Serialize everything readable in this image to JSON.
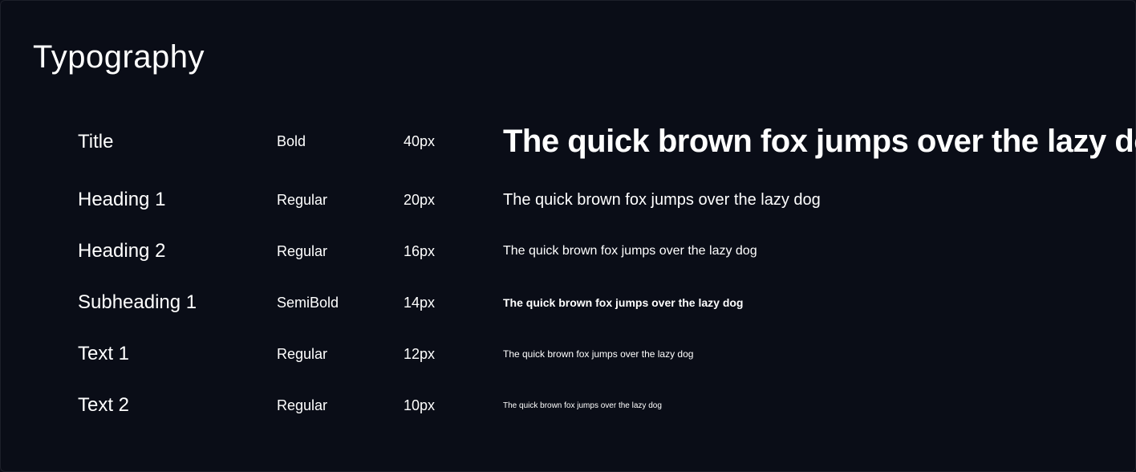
{
  "title": "Typography",
  "sample_text": "The quick brown fox jumps over the lazy dog",
  "rows": [
    {
      "name": "Title",
      "weight": "Bold",
      "size": "40px",
      "sample_class": "s-title"
    },
    {
      "name": "Heading 1",
      "weight": "Regular",
      "size": "20px",
      "sample_class": "s-h1"
    },
    {
      "name": "Heading 2",
      "weight": "Regular",
      "size": "16px",
      "sample_class": "s-h2"
    },
    {
      "name": "Subheading 1",
      "weight": "SemiBold",
      "size": "14px",
      "sample_class": "s-sub1"
    },
    {
      "name": "Text 1",
      "weight": "Regular",
      "size": "12px",
      "sample_class": "s-t1"
    },
    {
      "name": "Text 2",
      "weight": "Regular",
      "size": "10px",
      "sample_class": "s-t2"
    }
  ]
}
